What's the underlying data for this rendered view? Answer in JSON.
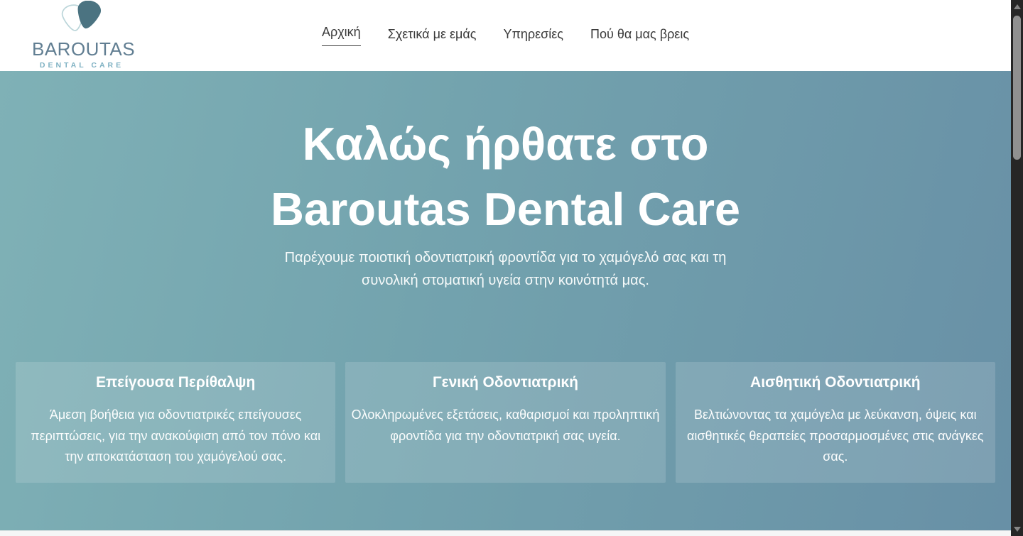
{
  "brand": {
    "name": "BAROUTAS",
    "tagline": "DENTAL CARE",
    "icon": "tooth-logo-icon"
  },
  "nav": {
    "items": [
      {
        "label": "Αρχική",
        "active": true
      },
      {
        "label": "Σχετικά με εμάς",
        "active": false
      },
      {
        "label": "Υπηρεσίες",
        "active": false
      },
      {
        "label": "Πού θα μας βρεις",
        "active": false
      }
    ]
  },
  "hero": {
    "title_line1": "Καλώς ήρθατε στο",
    "title_line2": "Baroutas Dental Care",
    "subtitle": "Παρέχουμε ποιοτική οδοντιατρική φροντίδα για το χαμόγελό σας και τη\nσυνολική στοματική υγεία στην κοινότητά μας.",
    "cards": [
      {
        "title": "Επείγουσα Περίθαλψη",
        "body": "Άμεση βοήθεια για οδοντιατρικές επείγουσες περιπτώσεις, για την ανακούφιση από τον πόνο και την αποκατάσταση του χαμόγελού σας."
      },
      {
        "title": "Γενική Οδοντιατρική",
        "body": "Ολοκληρωμένες εξετάσεις, καθαρισμοί και προληπτική φροντίδα για την οδοντιατρική σας υγεία."
      },
      {
        "title": "Αισθητική Οδοντιατρική",
        "body": "Βελτιώνοντας τα χαμόγελα με λεύκανση, όψεις και αισθητικές θεραπείες προσαρμοσμένες στις ανάγκες σας."
      }
    ]
  },
  "colors": {
    "hero_gradient_start": "#7fb1b6",
    "hero_gradient_end": "#6890a6",
    "card_background": "rgba(255,255,255,0.14)",
    "brand_name_text": "#617e92",
    "brand_tagline_text": "#7fb1c3",
    "logo_tooth_fill": "#4b7381",
    "logo_tooth_outline": "#bcd6da",
    "nav_text": "#3a3a3a",
    "hero_text": "#ffffff",
    "scrollbar_track": "#262626",
    "scrollbar_thumb": "#909090"
  }
}
